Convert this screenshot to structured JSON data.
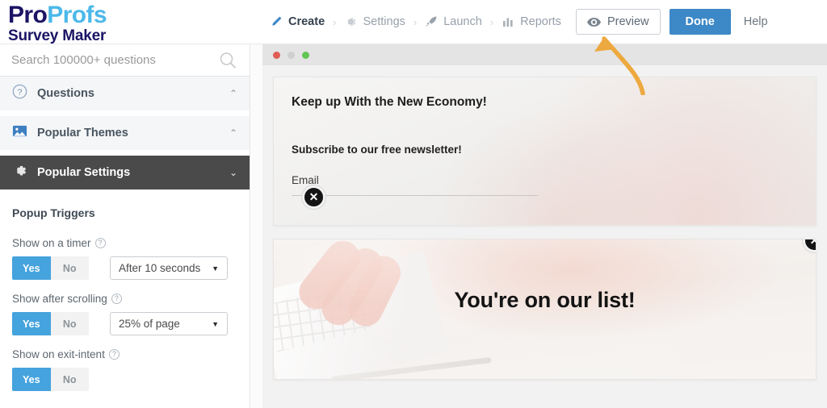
{
  "brand": {
    "name_part1": "Pro",
    "name_part2": "Profs",
    "tagline": "Survey Maker"
  },
  "nav": {
    "items": [
      {
        "label": "Create",
        "icon": "pencil-icon",
        "active": true
      },
      {
        "label": "Settings",
        "icon": "gear-icon",
        "active": false
      },
      {
        "label": "Launch",
        "icon": "rocket-icon",
        "active": false
      },
      {
        "label": "Reports",
        "icon": "bar-chart-icon",
        "active": false
      }
    ],
    "separator": "›",
    "preview_label": "Preview",
    "preview_icon": "eye-icon",
    "done_label": "Done",
    "help_label": "Help",
    "done_color": "#3d88c7"
  },
  "search": {
    "placeholder": "Search 100000+ questions",
    "value": "",
    "icon": "search-icon"
  },
  "sidebar": {
    "sections": [
      {
        "label": "Questions",
        "icon": "question-circle-icon",
        "chevron": "⌃",
        "state": "expanded",
        "style": "light"
      },
      {
        "label": "Popular Themes",
        "icon": "image-icon",
        "chevron": "⌃",
        "state": "expanded",
        "style": "light"
      },
      {
        "label": "Popular Settings",
        "icon": "gear-icon",
        "chevron": "⌄",
        "state": "collapsed",
        "style": "dark"
      }
    ],
    "panel": {
      "heading": "Popup Triggers",
      "fields": [
        {
          "label": "Show on a timer",
          "help_icon": "help-icon",
          "yes_label": "Yes",
          "no_label": "No",
          "selected": "Yes",
          "has_select": true,
          "select_value": "After 10 seconds"
        },
        {
          "label": "Show after scrolling",
          "help_icon": "help-icon",
          "yes_label": "Yes",
          "no_label": "No",
          "selected": "Yes",
          "has_select": true,
          "select_value": "25% of page"
        },
        {
          "label": "Show on exit-intent",
          "help_icon": "help-icon",
          "yes_label": "Yes",
          "no_label": "No",
          "selected": "Yes",
          "has_select": false,
          "select_value": ""
        }
      ]
    },
    "accent_color": "#45a3dd"
  },
  "preview": {
    "window_dots": [
      "red",
      "yellow",
      "green"
    ],
    "popups": [
      {
        "title": "Keep up With the New Economy!",
        "subtitle": "Subscribe to our free newsletter!",
        "email_placeholder": "Email",
        "close_icon": "close-icon"
      },
      {
        "message": "You're on our list!",
        "close_icon": "close-icon"
      }
    ]
  },
  "annotation": {
    "arrow_color": "#eda93f",
    "points_to": "Preview"
  }
}
